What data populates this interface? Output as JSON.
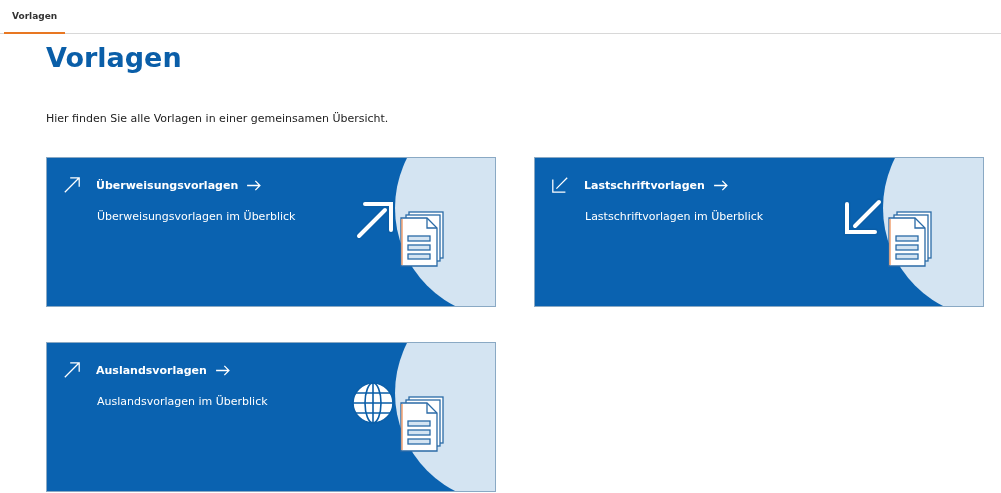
{
  "tabs": [
    {
      "label": "Vorlagen",
      "selected": true
    }
  ],
  "heading": "Vorlagen",
  "intro": "Hier finden Sie alle Vorlagen in einer gemeinsamen Übersicht.",
  "cards": [
    {
      "kind": "outgoing",
      "title": "Überweisungsvorlagen",
      "subtitle": "Überweisungsvorlagen im Überblick"
    },
    {
      "kind": "incoming",
      "title": "Lastschriftvorlagen",
      "subtitle": "Lastschriftvorlagen im Überblick"
    },
    {
      "kind": "foreign",
      "title": "Auslandsvorlagen",
      "subtitle": "Auslandsvorlagen im Überblick"
    }
  ]
}
